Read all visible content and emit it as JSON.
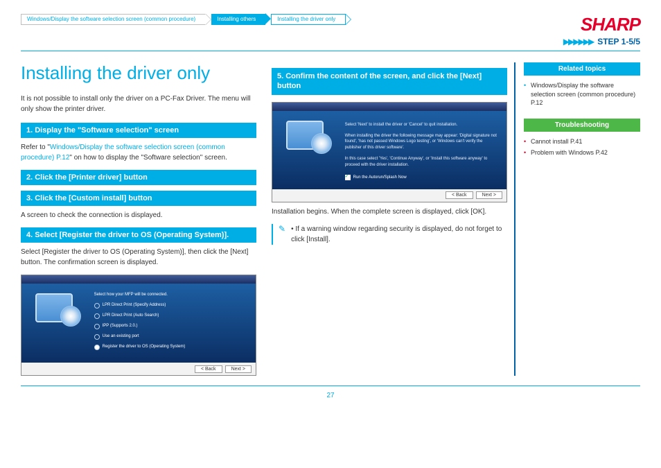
{
  "breadcrumbs": {
    "b1": "Windows/Display the software selection screen (common procedure)",
    "b2": "Installing others",
    "b3": "Installing the driver only"
  },
  "header": {
    "brand": "SHARP",
    "arrows": "▶▶▶▶▶▶",
    "step": "STEP  1-5/5"
  },
  "title": "Installing the driver only",
  "intro": "It is not possible to install only the driver on a PC-Fax Driver. The menu will only show the printer driver.",
  "step1": {
    "bar": "1.   Display the \"Software selection\" screen",
    "pre": "Refer to \"",
    "link": "Windows/Display the software selection screen (common procedure) P.12",
    "post": "\" on how to display the \"Software selection\" screen."
  },
  "step2": {
    "bar": "2.   Click the [Printer driver] button"
  },
  "step3": {
    "bar": "3.   Click the [Custom install] button",
    "text": "A screen to check the connection is displayed."
  },
  "step4": {
    "bar": "4.   Select [Register the driver to OS (Operating System)].",
    "text": "Select [Register the driver to OS (Operating System)], then click the [Next] button. The confirmation screen is displayed."
  },
  "installer1": {
    "prompt": "Select how your MFP will be connected.",
    "opt1": "LPR Direct Print (Specify Address)",
    "opt2": "LPR Direct Print (Auto Search)",
    "opt3": "IPP (Supports 2.0.)",
    "opt4": "Use an existing port",
    "opt5": "Register the driver to OS (Operating System)",
    "back": "< Back",
    "next": "Next >"
  },
  "step5": {
    "bar": "5.   Confirm the content of the screen, and click the [Next] button",
    "text": "Installation begins. When the complete screen is displayed, click [OK].",
    "note": "If a warning window regarding security is displayed, do not forget to click [Install]."
  },
  "installer2": {
    "line1": "Select 'Next' to install the driver or 'Cancel' to quit installation.",
    "line2": "When installing the driver the following message may appear: 'Digital signature not found', 'has not passed Windows Logo testing', or 'Windows can't verify the publisher of this driver software'.",
    "line3": "In this case select 'Yes', 'Continue Anyway', or 'Install this software anyway' to proceed with the driver installation.",
    "check": "Run the Autorun/Splash Now",
    "back": "< Back",
    "next": "Next >"
  },
  "sidebar": {
    "related_head": "Related topics",
    "related_1": "Windows/Display the software selection screen (common procedure) P.12",
    "trouble_head": "Troubleshooting",
    "trouble_1": "Cannot install P.41",
    "trouble_2": "Problem with Windows P.42"
  },
  "pageno": "27"
}
